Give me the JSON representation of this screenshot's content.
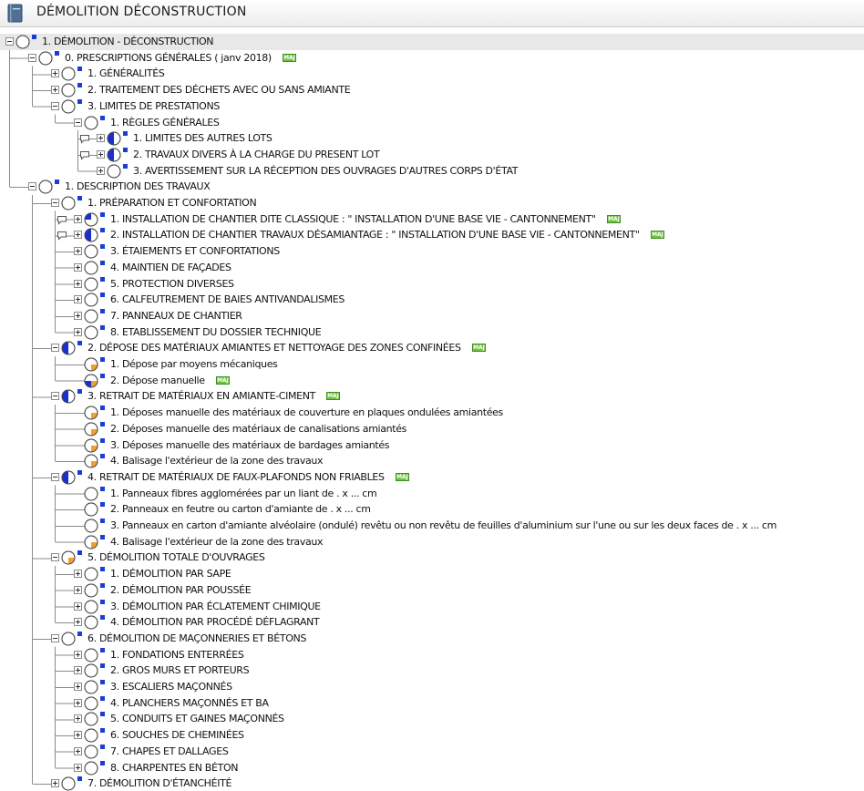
{
  "header": {
    "title": "DÉMOLITION  DÉCONSTRUCTION",
    "icon": "book-icon"
  },
  "badge_text": "MAJ",
  "colors": {
    "pie_blue": "#1a2fd0",
    "pie_orange": "#f0a030",
    "marker_blue": "#1c3cd8",
    "selection": "#e8e8e8",
    "maj_badge": "#6fc241"
  },
  "tree": {
    "rows": [
      {
        "depth": 0,
        "label": "1. DÉMOLITION - DÉCONSTRUCTION",
        "expander": "minus",
        "status": "empty",
        "marker": true,
        "comment": true,
        "maj": false,
        "selected": true
      },
      {
        "depth": 1,
        "label": "0. PRESCRIPTIONS GÉNÉRALES ( janv 2018)",
        "expander": "minus",
        "status": "empty",
        "marker": true,
        "comment": false,
        "maj": true
      },
      {
        "depth": 2,
        "label": "1. GÉNÉRALITÉS",
        "expander": "plus",
        "status": "empty",
        "marker": true,
        "comment": false,
        "maj": false
      },
      {
        "depth": 2,
        "label": "2. TRAITEMENT DES DÉCHETS AVEC OU SANS AMIANTE",
        "expander": "plus",
        "status": "empty",
        "marker": true,
        "comment": false,
        "maj": false
      },
      {
        "depth": 2,
        "label": "3. LIMITES DE PRESTATIONS",
        "expander": "minus",
        "status": "empty",
        "marker": true,
        "comment": false,
        "maj": false
      },
      {
        "depth": 3,
        "label": "1. RÈGLES GÉNÉRALES",
        "expander": "minus",
        "status": "empty",
        "marker": true,
        "comment": false,
        "maj": false
      },
      {
        "depth": 4,
        "label": "1. LIMITES DES AUTRES LOTS",
        "expander": "plus",
        "status": "half",
        "marker": true,
        "comment": true,
        "maj": false
      },
      {
        "depth": 4,
        "label": "2. TRAVAUX DIVERS À LA CHARGE DU PRESENT LOT",
        "expander": "plus",
        "status": "half",
        "marker": true,
        "comment": true,
        "maj": false
      },
      {
        "depth": 4,
        "label": "3. AVERTISSEMENT SUR LA RÉCEPTION DES OUVRAGES D'AUTRES CORPS D'ÉTAT",
        "expander": "plus",
        "status": "empty",
        "marker": true,
        "comment": false,
        "maj": false
      },
      {
        "depth": 1,
        "label": "1. DESCRIPTION DES TRAVAUX",
        "expander": "minus",
        "status": "empty",
        "marker": true,
        "comment": false,
        "maj": false
      },
      {
        "depth": 2,
        "label": "1. PRÉPARATION ET CONFORTATION",
        "expander": "minus",
        "status": "empty",
        "marker": true,
        "comment": false,
        "maj": false
      },
      {
        "depth": 3,
        "label": "1. INSTALLATION DE CHANTIER DITE CLASSIQUE : \" INSTALLATION D'UNE BASE VIE -  CANTONNEMENT\"",
        "expander": "plus",
        "status": "quarter",
        "marker": true,
        "comment": true,
        "maj": true
      },
      {
        "depth": 3,
        "label": "2. INSTALLATION DE CHANTIER TRAVAUX DÉSAMIANTAGE  : \" INSTALLATION D'UNE BASE VIE -  CANTONNEMENT\"",
        "expander": "plus",
        "status": "half",
        "marker": true,
        "comment": true,
        "maj": true
      },
      {
        "depth": 3,
        "label": "3. ÉTAIEMENTS ET CONFORTATIONS",
        "expander": "plus",
        "status": "empty",
        "marker": true,
        "comment": false,
        "maj": false
      },
      {
        "depth": 3,
        "label": "4. MAINTIEN DE FAÇADES",
        "expander": "plus",
        "status": "empty",
        "marker": true,
        "comment": false,
        "maj": false
      },
      {
        "depth": 3,
        "label": "5. PROTECTION DIVERSES",
        "expander": "plus",
        "status": "empty",
        "marker": true,
        "comment": false,
        "maj": false
      },
      {
        "depth": 3,
        "label": "6. CALFEUTREMENT DE BAIES ANTIVANDALISMES",
        "expander": "plus",
        "status": "empty",
        "marker": true,
        "comment": false,
        "maj": false
      },
      {
        "depth": 3,
        "label": "7. PANNEAUX DE CHANTIER",
        "expander": "plus",
        "status": "empty",
        "marker": true,
        "comment": false,
        "maj": false
      },
      {
        "depth": 3,
        "label": "8. ETABLISSEMENT DU DOSSIER TECHNIQUE",
        "expander": "plus",
        "status": "empty",
        "marker": true,
        "comment": false,
        "maj": false
      },
      {
        "depth": 2,
        "label": "2. DÉPOSE DES MATÉRIAUX AMIANTES ET NETTOYAGE DES ZONES CONFINÉES",
        "expander": "minus",
        "status": "half",
        "marker": true,
        "comment": false,
        "maj": true
      },
      {
        "depth": 3,
        "label": "1. Dépose par moyens mécaniques",
        "expander": "none",
        "status": "orange",
        "marker": true,
        "comment": false,
        "maj": false
      },
      {
        "depth": 3,
        "label": "2. Dépose manuelle",
        "expander": "none",
        "status": "mixed",
        "marker": true,
        "comment": false,
        "maj": true
      },
      {
        "depth": 2,
        "label": "3. RETRAIT DE MATÉRIAUX EN AMIANTE-CIMENT",
        "expander": "minus",
        "status": "half",
        "marker": true,
        "comment": false,
        "maj": true
      },
      {
        "depth": 3,
        "label": "1. Déposes manuelle des matériaux de couverture en plaques ondulées amiantées",
        "expander": "none",
        "status": "orange",
        "marker": true,
        "comment": false,
        "maj": false
      },
      {
        "depth": 3,
        "label": "2. Déposes manuelle des matériaux de canalisations amiantés",
        "expander": "none",
        "status": "orange",
        "marker": true,
        "comment": false,
        "maj": false
      },
      {
        "depth": 3,
        "label": "3. Déposes manuelle des matériaux de bardages amiantés",
        "expander": "none",
        "status": "orange",
        "marker": true,
        "comment": false,
        "maj": false
      },
      {
        "depth": 3,
        "label": "4. Balisage  l'extérieur de la zone des travaux",
        "expander": "none",
        "status": "orange",
        "marker": true,
        "comment": false,
        "maj": false
      },
      {
        "depth": 2,
        "label": "4. RETRAIT DE MATÉRIAUX DE FAUX-PLAFONDS NON FRIABLES",
        "expander": "minus",
        "status": "half",
        "marker": true,
        "comment": false,
        "maj": true
      },
      {
        "depth": 3,
        "label": "1. Panneaux fibres agglomérées par un liant de  . x ... cm",
        "expander": "none",
        "status": "empty",
        "marker": true,
        "comment": false,
        "maj": false
      },
      {
        "depth": 3,
        "label": "2. Panneaux en feutre ou carton d'amiante de  . x ... cm",
        "expander": "none",
        "status": "empty",
        "marker": true,
        "comment": false,
        "maj": false
      },
      {
        "depth": 3,
        "label": "3. Panneaux en carton d'amiante alvéolaire (ondulé) revêtu ou non revêtu de feuilles d'aluminium sur l'une ou sur les deux faces de  . x ... cm",
        "expander": "none",
        "status": "empty",
        "marker": true,
        "comment": false,
        "maj": false
      },
      {
        "depth": 3,
        "label": "4. Balisage  l'extérieur de la zone des travaux",
        "expander": "none",
        "status": "orange",
        "marker": true,
        "comment": false,
        "maj": false
      },
      {
        "depth": 2,
        "label": "5. DÉMOLITION TOTALE D'OUVRAGES",
        "expander": "minus",
        "status": "orange",
        "marker": true,
        "comment": false,
        "maj": false
      },
      {
        "depth": 3,
        "label": "1. DÉMOLITION PAR SAPE",
        "expander": "plus",
        "status": "empty",
        "marker": true,
        "comment": false,
        "maj": false
      },
      {
        "depth": 3,
        "label": "2. DÉMOLITION PAR POUSSÉE",
        "expander": "plus",
        "status": "empty",
        "marker": true,
        "comment": false,
        "maj": false
      },
      {
        "depth": 3,
        "label": "3. DÉMOLITION PAR ÉCLATEMENT CHIMIQUE",
        "expander": "plus",
        "status": "empty",
        "marker": true,
        "comment": false,
        "maj": false
      },
      {
        "depth": 3,
        "label": "4. DÉMOLITION PAR PROCÉDÉ DÉFLAGRANT",
        "expander": "plus",
        "status": "empty",
        "marker": true,
        "comment": false,
        "maj": false
      },
      {
        "depth": 2,
        "label": "6. DÉMOLITION DE MAÇONNERIES ET BÉTONS",
        "expander": "minus",
        "status": "empty",
        "marker": true,
        "comment": false,
        "maj": false
      },
      {
        "depth": 3,
        "label": "1. FONDATIONS ENTERRÉES",
        "expander": "plus",
        "status": "empty",
        "marker": true,
        "comment": false,
        "maj": false
      },
      {
        "depth": 3,
        "label": "2. GROS MURS ET PORTEURS",
        "expander": "plus",
        "status": "empty",
        "marker": true,
        "comment": false,
        "maj": false
      },
      {
        "depth": 3,
        "label": "3. ESCALIERS MAÇONNÉS",
        "expander": "plus",
        "status": "empty",
        "marker": true,
        "comment": false,
        "maj": false
      },
      {
        "depth": 3,
        "label": "4. PLANCHERS MAÇONNÉS ET BA",
        "expander": "plus",
        "status": "empty",
        "marker": true,
        "comment": false,
        "maj": false
      },
      {
        "depth": 3,
        "label": "5. CONDUITS ET GAINES MAÇONNÉS",
        "expander": "plus",
        "status": "empty",
        "marker": true,
        "comment": false,
        "maj": false
      },
      {
        "depth": 3,
        "label": "6. SOUCHES DE CHEMINÉES",
        "expander": "plus",
        "status": "empty",
        "marker": true,
        "comment": false,
        "maj": false
      },
      {
        "depth": 3,
        "label": "7. CHAPES ET DALLAGES",
        "expander": "plus",
        "status": "empty",
        "marker": true,
        "comment": false,
        "maj": false
      },
      {
        "depth": 3,
        "label": "8. CHARPENTES EN BÉTON",
        "expander": "plus",
        "status": "empty",
        "marker": true,
        "comment": false,
        "maj": false
      },
      {
        "depth": 2,
        "label": "7. DÉMOLITION D'ÉTANCHÉITÉ",
        "expander": "plus",
        "status": "empty",
        "marker": true,
        "comment": false,
        "maj": false
      }
    ]
  }
}
